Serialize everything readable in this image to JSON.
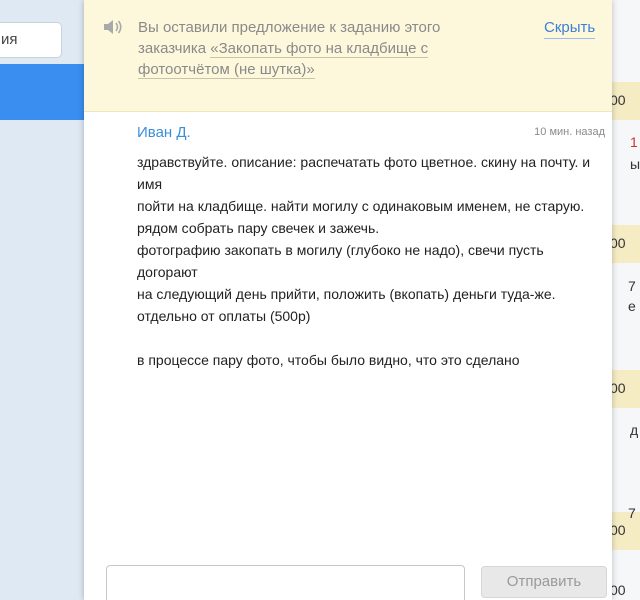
{
  "sidebar": {
    "search_fragment": "ия"
  },
  "background_right": {
    "fragments": [
      "00",
      "1",
      "ы",
      "00",
      "7",
      "е",
      "00",
      "д",
      "00",
      "7",
      "00"
    ]
  },
  "notice": {
    "icon": "speaker-icon",
    "text_prefix": "Вы оставили предложение к заданию этого заказчика ",
    "task_link": "«Закопать фото на кладбище с фотоотчётом (не шутка)»",
    "hide_label": "Скрыть"
  },
  "message": {
    "author": "Иван Д.",
    "time": "10 мин. назад",
    "lines": [
      "здравствуйте. описание: распечатать фото цветное. скину на почту. и имя",
      "пойти на кладбище. найти могилу с одинаковым именем, не старую.",
      "рядом собрать пару свечек и зажечь.",
      "фотографию закопать в могилу (глубоко не надо), свечи пусть догорают",
      "на следующий день прийти, положить (вкопать) деньги туда-же. отдельно от оплаты (500р)",
      "",
      "в процессе пару фото, чтобы было видно, что это сделано"
    ]
  },
  "reply": {
    "input_value": "",
    "send_label": "Отправить"
  },
  "colors": {
    "accent_blue": "#3a8ef0",
    "link_blue": "#3b7fd6",
    "notice_bg": "#fdf8dc"
  }
}
